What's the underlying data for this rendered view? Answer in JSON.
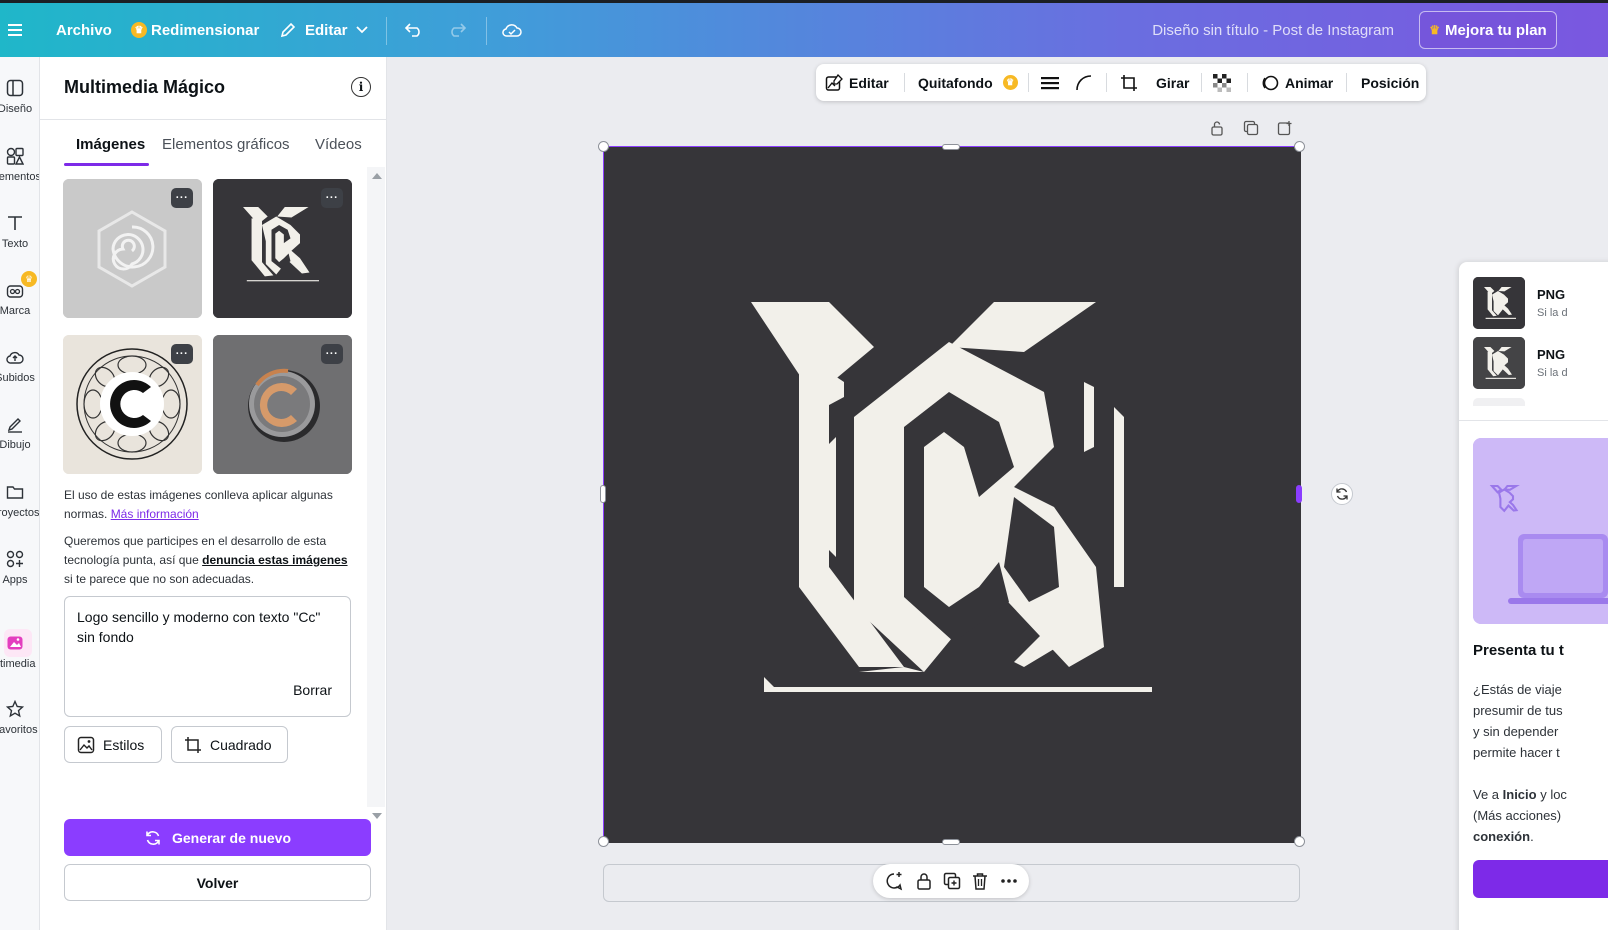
{
  "topbar": {
    "menu_icon": "hamburger-icon",
    "file": "Archivo",
    "resize": "Redimensionar",
    "edit": "Editar",
    "doc_title": "Diseño sin título - Post de Instagram",
    "upgrade": "Mejora tu plan"
  },
  "rail": {
    "items": [
      {
        "label": "Diseño",
        "icon": "layout-icon"
      },
      {
        "label": "Elementos",
        "icon": "shapes-icon"
      },
      {
        "label": "Texto",
        "icon": "text-icon"
      },
      {
        "label": "Marca",
        "icon": "brand-icon"
      },
      {
        "label": "Subidos",
        "icon": "cloud-upload-icon"
      },
      {
        "label": "Dibujo",
        "icon": "pen-icon"
      },
      {
        "label": "Proyectos",
        "icon": "folder-icon"
      },
      {
        "label": "Apps",
        "icon": "apps-icon"
      },
      {
        "label": "Multimedia ...",
        "icon": "magic-media-icon"
      },
      {
        "label": "Favoritos",
        "icon": "star-icon"
      }
    ]
  },
  "panel": {
    "title": "Multimedia Mágico",
    "tabs": [
      "Imágenes",
      "Elementos gráficos",
      "Vídeos"
    ],
    "thumb_menu": "···",
    "note1_a": "El uso de estas imágenes conlleva aplicar algunas normas. ",
    "note1_link": "Más información",
    "note2_a": "Queremos que participes en el desarrollo de esta tecnología punta, así que ",
    "note2_link": "denuncia estas imágenes",
    "note2_b": " si te parece que no son adecuadas.",
    "prompt": "Logo sencillo y moderno con texto \"Cc\" sin fondo",
    "clear": "Borrar",
    "styles": "Estilos",
    "format": "Cuadrado",
    "generate": "Generar de nuevo",
    "back": "Volver"
  },
  "toolbar": {
    "edit": "Editar",
    "bg_remover": "Quitafondo",
    "flip": "Girar",
    "animate": "Animar",
    "position": "Posición"
  },
  "download": {
    "row1_label": "PNG",
    "row1_sub": "Si la d",
    "row2_label": "PNG",
    "row2_sub": "Si la d",
    "promo_title": "Presenta tu t",
    "promo_lines": [
      "¿Estás de viaje",
      "presumir de tus",
      "y sin depender",
      "permite hacer t"
    ],
    "promo_line2_a": "Ve a ",
    "promo_line2_b": "Inicio",
    "promo_line2_c": " y loc",
    "promo_line3": "(Más acciones)",
    "promo_line4": "conexión",
    "promo_line4_tail": "."
  },
  "colors": {
    "accent": "#8b3dff",
    "canvas_bg": "#363539",
    "logo": "#f2f0ea"
  }
}
